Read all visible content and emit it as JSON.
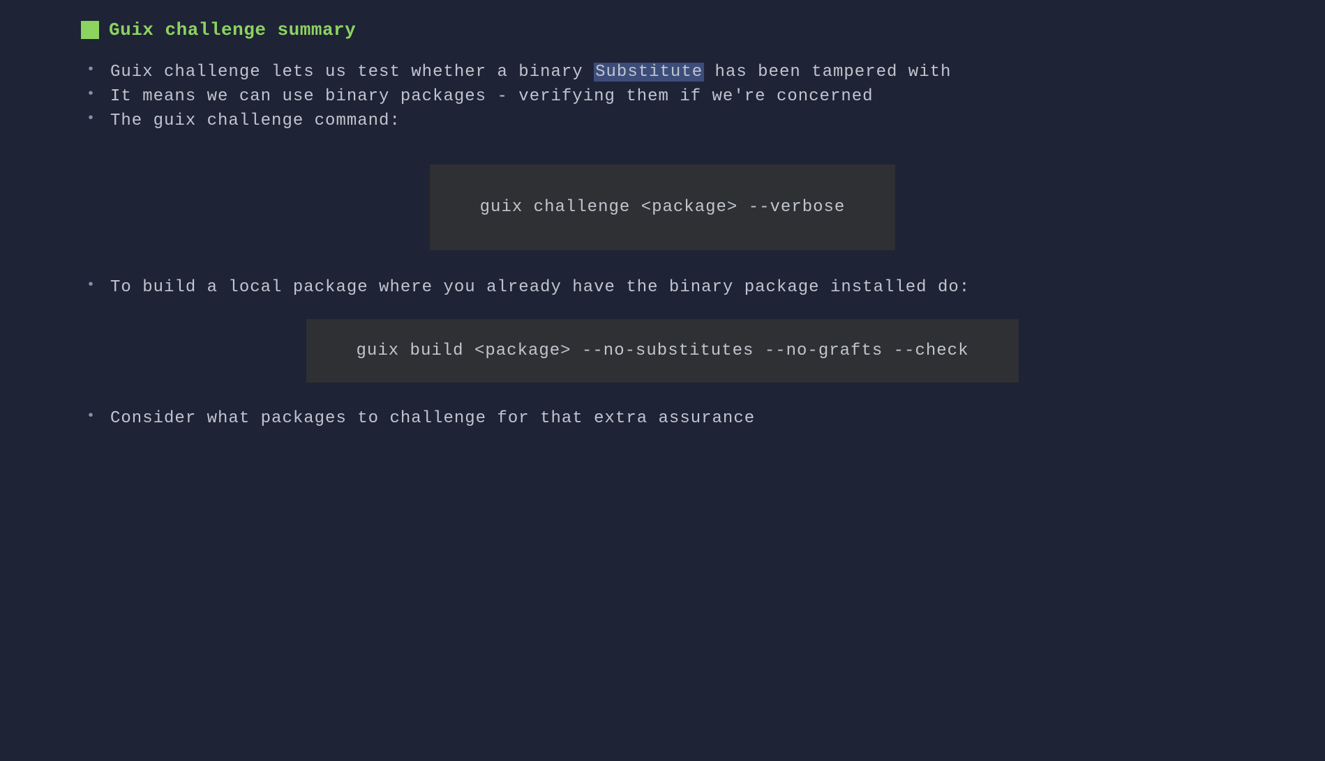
{
  "title": "Guix challenge summary",
  "bullets": {
    "item1_before": "Guix challenge lets us test whether a binary ",
    "item1_highlight": "Substitute",
    "item1_after": " has been tampered with",
    "item2": "It means we can use binary packages - verifying them if we're concerned",
    "item3": "The guix challenge command:",
    "item4": "To build a local package where you already have the binary package installed do:",
    "item5": "Consider what packages to challenge for that extra assurance"
  },
  "code": {
    "block1": "guix challenge <package> --verbose",
    "block2": "guix build <package> --no-substitutes --no-grafts --check"
  }
}
